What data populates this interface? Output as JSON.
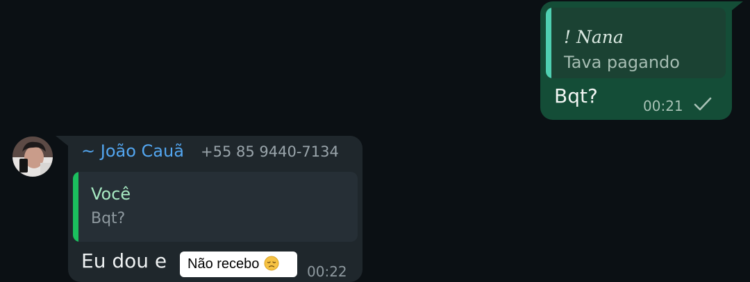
{
  "outgoing_message": {
    "reply_to": {
      "author": "! Nana",
      "text": "Tava pagando"
    },
    "text": "Bqt?",
    "time": "00:21",
    "status_icon": "single-check-icon"
  },
  "incoming_message": {
    "sender": {
      "name": "~ João Cauã",
      "phone": "+55 85 9440-7134",
      "avatar": "avatar"
    },
    "reply_to": {
      "author": "Você",
      "text": "Bqt?"
    },
    "text": "Eu dou e",
    "sticker_text": "Não recebo",
    "sticker_emoji": "disappointed-face-icon",
    "time": "00:22"
  },
  "colors": {
    "background": "#0b1014",
    "outgoing_bubble": "#144d37",
    "incoming_bubble": "#1f272c",
    "sender_name": "#53a6f0",
    "quote_bar_outgoing": "#4fcfb1",
    "quote_bar_incoming": "#1bbf5e"
  }
}
